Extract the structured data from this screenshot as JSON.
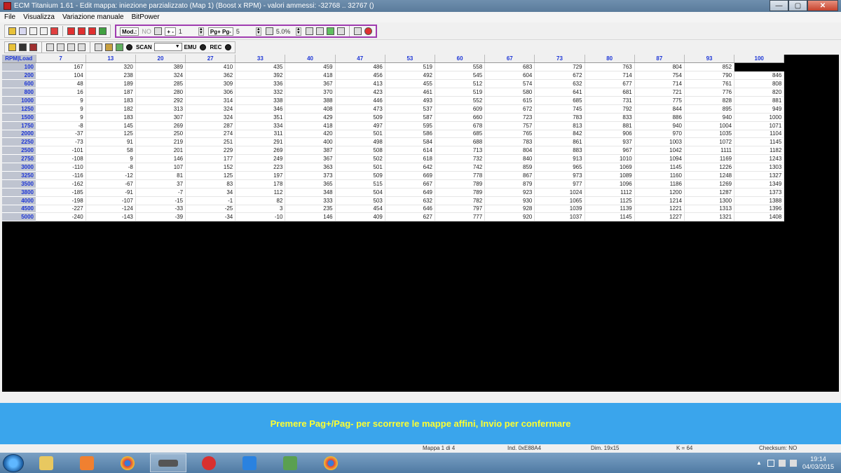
{
  "window": {
    "title": "ECM Titanium 1.61 - Edit mappa: iniezione parzializzato (Map 1) (Boost x RPM) - valori ammessi: -32768 .. 32767 ()",
    "controls": {
      "minimize": "—",
      "maximize": "▢",
      "close": "✕"
    }
  },
  "menu": {
    "items": [
      "File",
      "Visualizza",
      "Variazione manuale",
      "BitPower"
    ]
  },
  "toolbar": {
    "mod_label": "Mod.:",
    "mod_value": "NO",
    "step_label": "+ -",
    "step_value": "1",
    "page_label": "Pg+ Pg-",
    "page_value": "5",
    "percent_value": "5.0%",
    "scan_label": "SCAN",
    "emu_label": "EMU",
    "rec_label": "REC"
  },
  "table": {
    "corner_label": "RPM|Load",
    "columns": [
      "7",
      "13",
      "20",
      "27",
      "33",
      "40",
      "47",
      "53",
      "60",
      "67",
      "73",
      "80",
      "87",
      "93",
      "100"
    ],
    "rows": [
      {
        "rpm": "100",
        "values": [
          "167",
          "320",
          "389",
          "410",
          "435",
          "459",
          "486",
          "519",
          "558",
          "683",
          "729",
          "763",
          "804",
          "852"
        ]
      },
      {
        "rpm": "200",
        "values": [
          "104",
          "238",
          "324",
          "362",
          "392",
          "418",
          "456",
          "492",
          "545",
          "604",
          "672",
          "714",
          "754",
          "790",
          "846"
        ]
      },
      {
        "rpm": "600",
        "values": [
          "48",
          "189",
          "285",
          "309",
          "336",
          "367",
          "413",
          "455",
          "512",
          "574",
          "632",
          "677",
          "714",
          "761",
          "808"
        ]
      },
      {
        "rpm": "800",
        "values": [
          "16",
          "187",
          "280",
          "306",
          "332",
          "370",
          "423",
          "461",
          "519",
          "580",
          "641",
          "681",
          "721",
          "776",
          "820"
        ]
      },
      {
        "rpm": "1000",
        "values": [
          "9",
          "183",
          "292",
          "314",
          "338",
          "388",
          "446",
          "493",
          "552",
          "615",
          "685",
          "731",
          "775",
          "828",
          "881"
        ]
      },
      {
        "rpm": "1250",
        "values": [
          "9",
          "182",
          "313",
          "324",
          "346",
          "408",
          "473",
          "537",
          "609",
          "672",
          "745",
          "792",
          "844",
          "895",
          "949"
        ]
      },
      {
        "rpm": "1500",
        "values": [
          "9",
          "183",
          "307",
          "324",
          "351",
          "429",
          "509",
          "587",
          "660",
          "723",
          "783",
          "833",
          "886",
          "940",
          "1000"
        ]
      },
      {
        "rpm": "1750",
        "values": [
          "-8",
          "145",
          "269",
          "287",
          "334",
          "418",
          "497",
          "595",
          "678",
          "757",
          "813",
          "881",
          "940",
          "1004",
          "1071"
        ]
      },
      {
        "rpm": "2000",
        "values": [
          "-37",
          "125",
          "250",
          "274",
          "311",
          "420",
          "501",
          "586",
          "685",
          "765",
          "842",
          "906",
          "970",
          "1035",
          "1104"
        ]
      },
      {
        "rpm": "2250",
        "values": [
          "-73",
          "91",
          "219",
          "251",
          "291",
          "400",
          "498",
          "584",
          "688",
          "783",
          "861",
          "937",
          "1003",
          "1072",
          "1145"
        ]
      },
      {
        "rpm": "2500",
        "values": [
          "-101",
          "58",
          "201",
          "229",
          "269",
          "387",
          "508",
          "614",
          "713",
          "804",
          "883",
          "967",
          "1042",
          "1111",
          "1182"
        ]
      },
      {
        "rpm": "2750",
        "values": [
          "-108",
          "9",
          "146",
          "177",
          "249",
          "367",
          "502",
          "618",
          "732",
          "840",
          "913",
          "1010",
          "1094",
          "1169",
          "1243"
        ]
      },
      {
        "rpm": "3000",
        "values": [
          "-110",
          "-8",
          "107",
          "152",
          "223",
          "363",
          "501",
          "642",
          "742",
          "859",
          "965",
          "1069",
          "1145",
          "1226",
          "1303"
        ]
      },
      {
        "rpm": "3250",
        "values": [
          "-116",
          "-12",
          "81",
          "125",
          "197",
          "373",
          "509",
          "669",
          "778",
          "867",
          "973",
          "1089",
          "1160",
          "1248",
          "1327"
        ]
      },
      {
        "rpm": "3500",
        "values": [
          "-162",
          "-67",
          "37",
          "83",
          "178",
          "365",
          "515",
          "667",
          "789",
          "879",
          "977",
          "1096",
          "1186",
          "1269",
          "1349"
        ]
      },
      {
        "rpm": "3800",
        "values": [
          "-185",
          "-91",
          "-7",
          "34",
          "112",
          "348",
          "504",
          "649",
          "789",
          "923",
          "1024",
          "1112",
          "1200",
          "1287",
          "1373"
        ]
      },
      {
        "rpm": "4000",
        "values": [
          "-198",
          "-107",
          "-15",
          "-1",
          "82",
          "333",
          "503",
          "632",
          "782",
          "930",
          "1065",
          "1125",
          "1214",
          "1300",
          "1388"
        ]
      },
      {
        "rpm": "4500",
        "values": [
          "-227",
          "-124",
          "-33",
          "-25",
          "3",
          "235",
          "454",
          "646",
          "797",
          "928",
          "1039",
          "1139",
          "1221",
          "1313",
          "1396"
        ]
      },
      {
        "rpm": "5000",
        "values": [
          "-240",
          "-143",
          "-39",
          "-34",
          "-10",
          "146",
          "409",
          "627",
          "777",
          "920",
          "1037",
          "1145",
          "1227",
          "1321",
          "1408"
        ]
      }
    ]
  },
  "info": {
    "message": "Premere Pag+/Pag- per scorrere le mappe affini, Invio per confermare"
  },
  "status": {
    "map": "Mappa 1 di 4",
    "ind": "Ind. 0xE88A4",
    "dim": "Dim. 19x15",
    "k": "K = 64",
    "checksum": "Checksum: NO"
  },
  "taskbar": {
    "time": "19:14",
    "date": "04/03/2015",
    "tray_arrow": "▲"
  },
  "colors": {
    "header_text": "#1c35d6",
    "info_bg": "#3aa5ec",
    "info_text": "#ffff30"
  }
}
